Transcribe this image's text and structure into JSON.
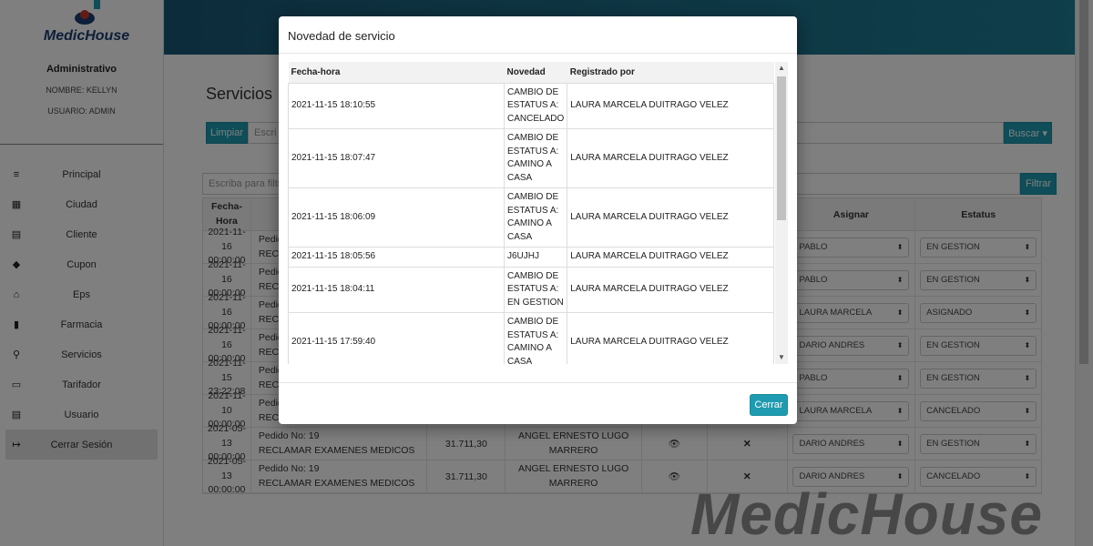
{
  "brand": {
    "name": "MedicHouse"
  },
  "user": {
    "role": "Administrativo",
    "name_line": "NOMBRE: KELLYN",
    "user_line": "USUARIO: ADMIN"
  },
  "nav": [
    {
      "label": "Principal",
      "icon": "≡"
    },
    {
      "label": "Ciudad",
      "icon": "▦"
    },
    {
      "label": "Cliente",
      "icon": "▤"
    },
    {
      "label": "Cupon",
      "icon": "◆"
    },
    {
      "label": "Eps",
      "icon": "⌂"
    },
    {
      "label": "Farmacia",
      "icon": "▮"
    },
    {
      "label": "Servicios",
      "icon": "⚲"
    },
    {
      "label": "Tarifador",
      "icon": "▭"
    },
    {
      "label": "Usuario",
      "icon": "▤"
    },
    {
      "label": "Cerrar Sesión",
      "icon": "↦"
    }
  ],
  "page": {
    "title": "Servicios",
    "clear_label": "Limpiar",
    "search_placeholder": "Escri",
    "search_label": "Buscar ▾",
    "filter_placeholder": "Escriba para filtra",
    "filter_label": "Filtrar"
  },
  "grid": {
    "headers": {
      "date": "Fecha-\nHora",
      "assign": "Asignar",
      "status": "Estatus"
    },
    "rows": [
      {
        "date": "2021-11-16",
        "time": "00:00:00",
        "pedido": "Pedid",
        "reclamar": "RECLAM",
        "assign": "PABLO",
        "status": "EN GESTION"
      },
      {
        "date": "2021-11-16",
        "time": "00:00:00",
        "pedido": "Pedid",
        "reclamar": "RECL",
        "assign": "PABLO",
        "status": "EN GESTION"
      },
      {
        "date": "2021-11-16",
        "time": "00:00:00",
        "pedido": "Pedid",
        "reclamar": "RECL",
        "assign": "LAURA MARCELA",
        "status": "ASIGNADO"
      },
      {
        "date": "2021-11-16",
        "time": "00:00:00",
        "pedido": "Pedid",
        "reclamar": "RECL",
        "assign": "DARIO ANDRES",
        "status": "EN GESTION"
      },
      {
        "date": "2021-11-15",
        "time": "23:22:08",
        "pedido": "Pedid",
        "reclamar": "RECL",
        "assign": "PABLO",
        "status": "EN GESTION"
      },
      {
        "date": "2021-11-10",
        "time": "00:00:00",
        "pedido": "Pedid",
        "reclamar": "RECL",
        "assign": "LAURA MARCELA",
        "status": "CANCELADO"
      },
      {
        "date": "2021-05-13",
        "time": "00:00:00",
        "pedido": "Pedido No: 19",
        "reclamar": "RECLAMAR EXAMENES MEDICOS",
        "amount": "31.711,30",
        "name1": "ANGEL ERNESTO LUGO",
        "name2": "MARRERO",
        "assign": "DARIO ANDRES",
        "status": "EN GESTION"
      },
      {
        "date": "2021-05-13",
        "time": "00:00:00",
        "pedido": "Pedido No: 19",
        "reclamar": "RECLAMAR EXAMENES MEDICOS",
        "amount": "31.711,30",
        "name1": "ANGEL ERNESTO LUGO",
        "name2": "MARRERO",
        "assign": "DARIO ANDRES",
        "status": "CANCELADO"
      }
    ]
  },
  "modal": {
    "title": "Novedad de servicio",
    "headers": {
      "datetime": "Fecha-hora",
      "novedad": "Novedad",
      "registered": "Registrado por"
    },
    "rows": [
      {
        "datetime": "2021-11-15 18:10:55",
        "novedad": [
          "CAMBIO DE",
          "ESTATUS A:",
          "CANCELADO"
        ],
        "registered": "LAURA MARCELA DUITRAGO VELEZ"
      },
      {
        "datetime": "2021-11-15 18:07:47",
        "novedad": [
          "CAMBIO DE",
          "ESTATUS A:",
          "CAMINO A",
          "CASA"
        ],
        "registered": "LAURA MARCELA DUITRAGO VELEZ"
      },
      {
        "datetime": "2021-11-15 18:06:09",
        "novedad": [
          "CAMBIO DE",
          "ESTATUS A:",
          "CAMINO A",
          "CASA"
        ],
        "registered": "LAURA MARCELA DUITRAGO VELEZ"
      },
      {
        "datetime": "2021-11-15 18:05:56",
        "novedad": [
          "J6UJHJ"
        ],
        "registered": "LAURA MARCELA DUITRAGO VELEZ"
      },
      {
        "datetime": "2021-11-15 18:04:11",
        "novedad": [
          "CAMBIO DE",
          "ESTATUS A:",
          "EN GESTION"
        ],
        "registered": "LAURA MARCELA DUITRAGO VELEZ"
      },
      {
        "datetime": "2021-11-15 17:59:40",
        "novedad": [
          "CAMBIO DE",
          "ESTATUS A:",
          "CAMINO A",
          "CASA"
        ],
        "registered": "LAURA MARCELA DUITRAGO VELEZ"
      }
    ],
    "close_label": "Cerrar"
  },
  "colors": {
    "accent": "#1e9bb0",
    "topbar": "#1b5876",
    "brand_text": "#1b3e73"
  }
}
